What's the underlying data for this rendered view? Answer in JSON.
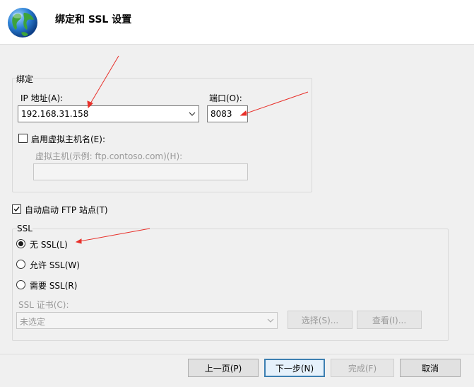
{
  "header": {
    "title": "绑定和 SSL 设置",
    "icon": "globe-icon"
  },
  "binding": {
    "group_label": "绑定",
    "ip_label": "IP 地址(A):",
    "ip_value": "192.168.31.158",
    "port_label": "端口(O):",
    "port_value": "8083",
    "virtual_host_checkbox_label": "启用虚拟主机名(E):",
    "virtual_host_checked": false,
    "virtual_host_label": "虚拟主机(示例: ftp.contoso.com)(H):",
    "virtual_host_value": ""
  },
  "autostart": {
    "label": "自动启动 FTP 站点(T)",
    "checked": true
  },
  "ssl": {
    "group_label": "SSL",
    "options": [
      {
        "label": "无 SSL(L)",
        "selected": true
      },
      {
        "label": "允许 SSL(W)",
        "selected": false
      },
      {
        "label": "需要 SSL(R)",
        "selected": false
      }
    ],
    "cert_label": "SSL 证书(C):",
    "cert_value": "未选定",
    "select_button": "选择(S)...",
    "view_button": "查看(I)..."
  },
  "footer": {
    "prev_button": "上一页(P)",
    "next_button": "下一步(N)",
    "finish_button": "完成(F)",
    "cancel_button": "取消"
  },
  "colors": {
    "annotation_arrow": "#e8302a",
    "default_button_border": "#3c7fb1"
  }
}
